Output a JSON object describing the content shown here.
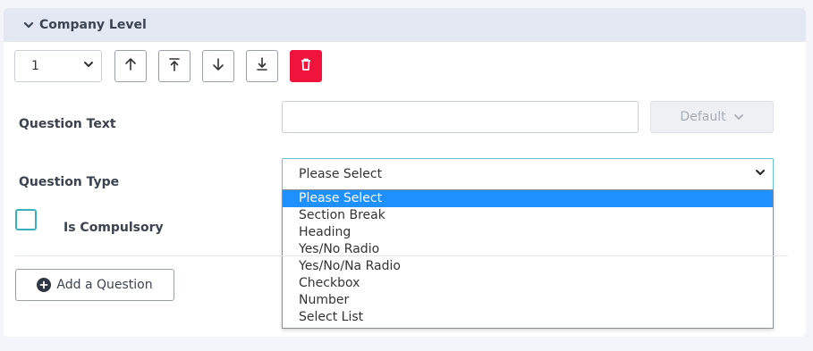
{
  "section": {
    "title": "Company Level"
  },
  "toolbar": {
    "order_value": "1",
    "icons": [
      "arrow-up-icon",
      "move-top-icon",
      "arrow-down-icon",
      "move-bottom-icon",
      "trash-icon"
    ],
    "danger_color": "#f0143c"
  },
  "question_text": {
    "label": "Question Text",
    "value": ""
  },
  "default_button": {
    "label": "Default"
  },
  "question_type": {
    "label": "Question Type",
    "selected": "Please Select",
    "options": [
      "Please Select",
      "Section Break",
      "Heading",
      "Yes/No Radio",
      "Yes/No/Na Radio",
      "Checkbox",
      "Number",
      "Select List"
    ]
  },
  "compulsory": {
    "label": "Is Compulsory",
    "checked": false
  },
  "add_question": {
    "label": "Add a Question"
  },
  "colors": {
    "header_bg": "#e3e8f3",
    "highlight": "#1e90ff",
    "focus_border": "#64c3cc"
  }
}
